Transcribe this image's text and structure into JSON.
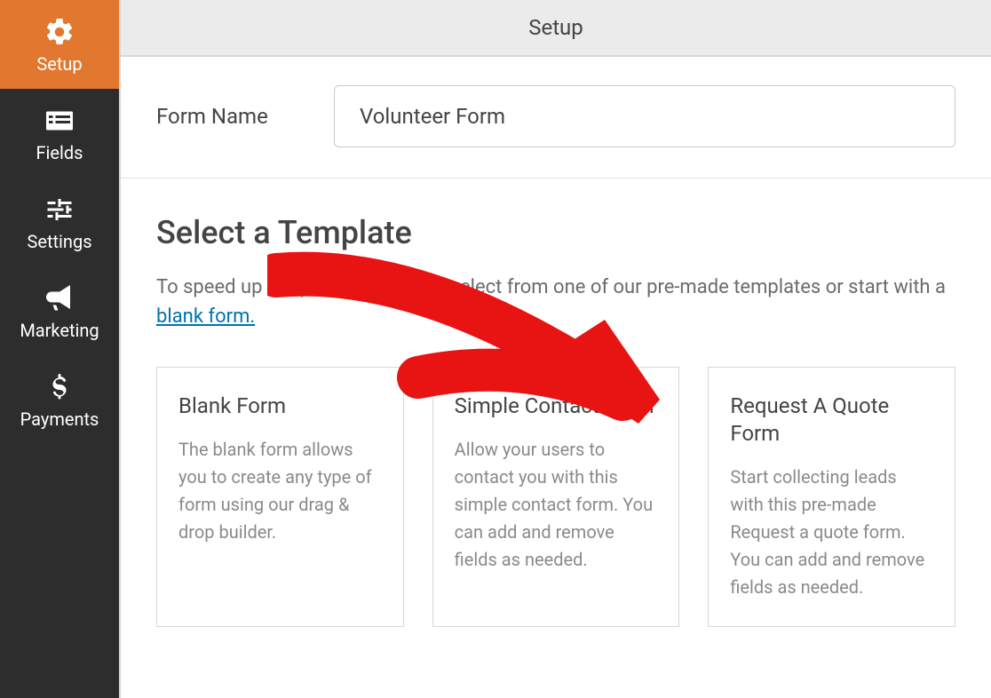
{
  "sidebar": {
    "items": [
      {
        "label": "Setup"
      },
      {
        "label": "Fields"
      },
      {
        "label": "Settings"
      },
      {
        "label": "Marketing"
      },
      {
        "label": "Payments"
      }
    ]
  },
  "topbar": {
    "title": "Setup"
  },
  "form_name": {
    "label": "Form Name",
    "value": "Volunteer Form"
  },
  "template_section": {
    "title": "Select a Template",
    "desc_prefix": "To speed up the process, you can select from one of our pre-made templates or start with a ",
    "desc_link": "blank form.",
    "templates": [
      {
        "title": "Blank Form",
        "desc": "The blank form allows you to create any type of form using our drag & drop builder."
      },
      {
        "title": "Simple Contact Form",
        "desc": "Allow your users to contact you with this simple contact form. You can add and remove fields as needed."
      },
      {
        "title": "Request A Quote Form",
        "desc": "Start collecting leads with this pre-made Request a quote form. You can add and remove fields as needed."
      }
    ]
  }
}
